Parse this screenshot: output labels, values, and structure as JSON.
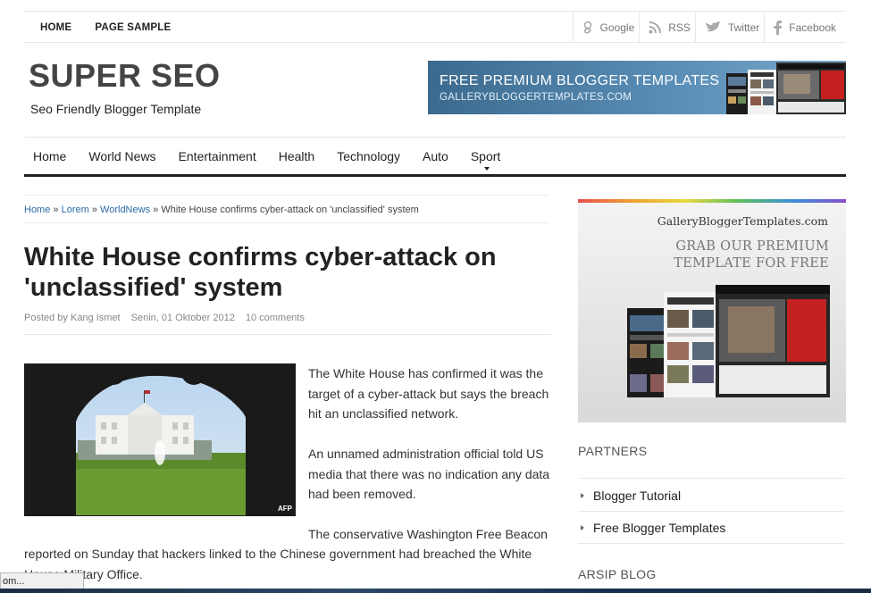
{
  "topbar": {
    "nav": [
      "HOME",
      "PAGE SAMPLE"
    ],
    "social": [
      {
        "icon": "google-icon",
        "label": "Google"
      },
      {
        "icon": "rss-icon",
        "label": "RSS"
      },
      {
        "icon": "twitter-icon",
        "label": "Twitter"
      },
      {
        "icon": "facebook-icon",
        "label": "Facebook"
      }
    ]
  },
  "header": {
    "title": "SUPER SEO",
    "tagline": "Seo Friendly Blogger Template",
    "banner": {
      "line1": "FREE PREMIUM BLOGGER TEMPLATES",
      "line2": "GALLERYBLOGGERTEMPLATES.COM"
    }
  },
  "mainnav": [
    "Home",
    "World News",
    "Entertainment",
    "Health",
    "Technology",
    "Auto",
    "Sport"
  ],
  "breadcrumb": {
    "links": [
      "Home",
      "Lorem",
      "WorldNews"
    ],
    "separator": "»",
    "current": "White House confirms cyber-attack on 'unclassified' system"
  },
  "post": {
    "title": "White House confirms cyber-attack on 'unclassified' system",
    "author": "Posted by Kang Ismet",
    "date": "Senin, 01 Oktober 2012",
    "comments": "10 comments",
    "image_credit": "AFP",
    "p1": "The White House has confirmed it was the target of a cyber-attack but says the breach hit an unclassified network.",
    "p2": "An unnamed administration official told US media that there was no indication any data had been removed.",
    "p3a": "The conservative Washington Free Beacon",
    "p3b": "reported on Sunday that hackers linked to the Chinese government had breached the White House Military Office."
  },
  "sidebar": {
    "ad": {
      "site": "GalleryBloggerTemplates.com",
      "headline": "GRAB OUR PREMIUM TEMPLATE FOR FREE"
    },
    "partners_title": "PARTNERS",
    "partners": [
      "Blogger Tutorial",
      "Free Blogger Templates"
    ],
    "arsip_title": "ARSIP BLOG"
  },
  "statusbar": {
    "text": "om..."
  },
  "colors": {
    "link": "#2a6aa8",
    "nav_rule": "#222222",
    "banner": "#4a7ca4"
  }
}
